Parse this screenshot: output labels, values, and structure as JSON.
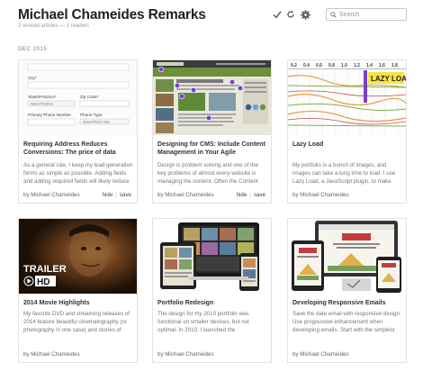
{
  "header": {
    "title": "Michael Chameides Remarks",
    "subtitle": "2 unread articles — 1 readers",
    "icons": [
      "check-icon",
      "refresh-icon",
      "gear-icon"
    ],
    "search_placeholder": "Search"
  },
  "section": {
    "date": "DEC 2015"
  },
  "cards": [
    {
      "title": "Requiring Address Reduces Conversions: The price of data",
      "excerpt": "As a general rule, I keep my lead generation forms as simple as possible. Adding fields and adding required fields will likely reduce",
      "author": "by Michael Chameides",
      "hide": "hide",
      "save": "save",
      "thumb": {
        "kind": "form",
        "labels": [
          "City*",
          "State/Province*",
          "Zip Code*",
          "Primary Phone Number",
          "Phone Type"
        ],
        "selects": [
          "Select Province",
          "Select Phone Type"
        ]
      }
    },
    {
      "title": "Designing for CMS: Include Content Management in Your Agile",
      "excerpt": "Design is problem solving and one of the key problems of almost every website is managing the content. Often the Content",
      "author": "by Michael Chameides",
      "hide": "hide",
      "save": "save",
      "thumb": {
        "kind": "website"
      }
    },
    {
      "title": "Lazy Load",
      "excerpt": "My portfolio is a bunch of images, and images can take a long time to load. I use Lazy Load, a JavaScript plugin, to make sure",
      "author": "by Michael Chameides",
      "hide": "",
      "save": "",
      "thumb": {
        "kind": "waterfall",
        "ticks": [
          "0.2",
          "0.4",
          "0.6",
          "0.8",
          "1.0",
          "1.2",
          "1.4",
          "1.6",
          "1.8"
        ],
        "overlay": "LAZY LOAD"
      }
    },
    {
      "title": "2014 Movie Highlights",
      "excerpt": "My favorite DVD and streaming releases of 2014 feature beautiful cinematography (or photography in one case) and stories of",
      "author": "by Michael Chameides",
      "hide": "",
      "save": "",
      "thumb": {
        "kind": "trailer",
        "line1": "TRAILER",
        "line2": "HD"
      }
    },
    {
      "title": "Portfolio Redesign",
      "excerpt": "The design for my 2010 portfolio was functional on smaller devices, but not optimal. In 2010, I launched the",
      "author": "by Michael Chameides",
      "hide": "",
      "save": "",
      "thumb": {
        "kind": "devices"
      }
    },
    {
      "title": "Developing Responsive Emails",
      "excerpt": "Save the date email with responsive design Use progressive enhancement when developing emails. Start with the simplest",
      "author": "by Michael Chameides",
      "hide": "",
      "save": "",
      "thumb": {
        "kind": "email"
      }
    }
  ],
  "colors": {
    "accent_purple": "#7b3fd0",
    "lazy_yellow": "#f4e542",
    "site_green": "#5a7b2e",
    "site_dark": "#2f2f2f"
  }
}
